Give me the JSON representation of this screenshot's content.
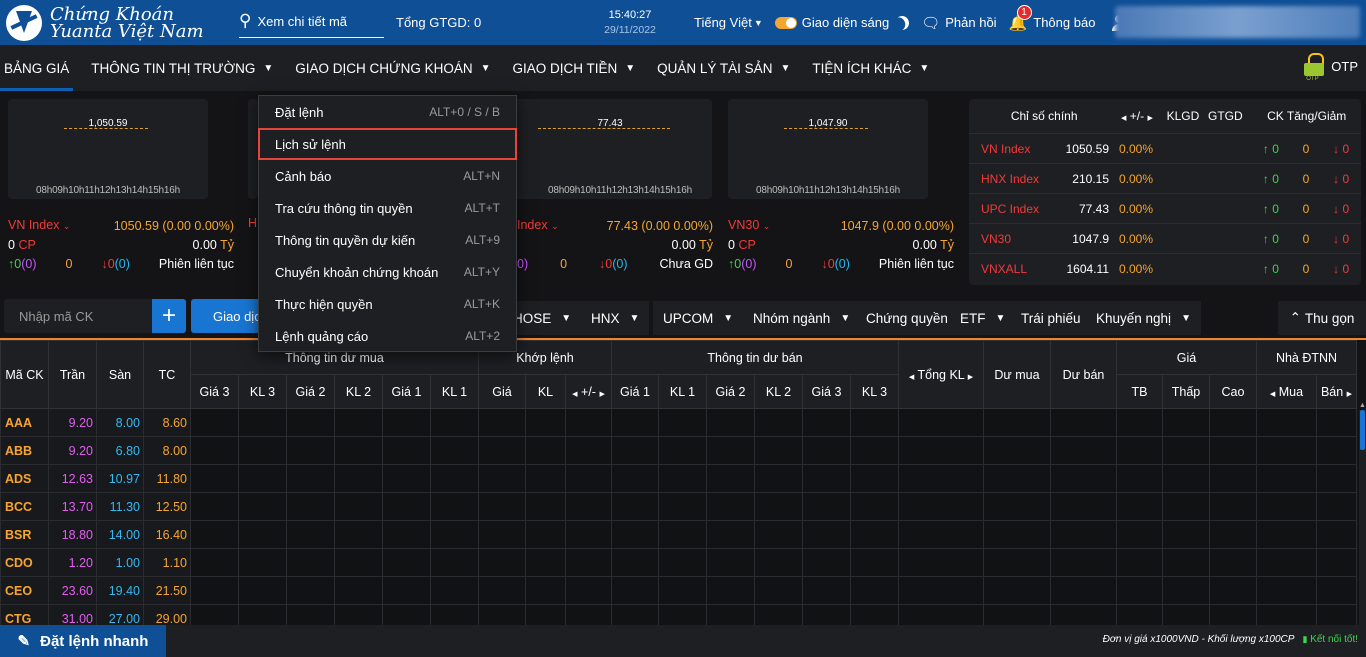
{
  "header": {
    "brand_line1": "Chứng Khoán",
    "brand_line2": "Yuanta Việt Nam",
    "search_placeholder": "Xem chi tiết mã",
    "total_gtgd": "Tổng GTGD: 0",
    "time": "15:40:27",
    "date": "29/11/2022",
    "language": "Tiếng Việt",
    "theme": "Giao diện sáng",
    "feedback": "Phản hồi",
    "notifications": "Thông báo",
    "notification_count": "1"
  },
  "menu": {
    "items": [
      "BẢNG GIÁ",
      "THÔNG TIN THỊ TRƯỜNG",
      "GIAO DỊCH CHỨNG KHOÁN",
      "GIAO DỊCH TIỀN",
      "QUẢN LÝ TÀI SẢN",
      "TIỆN ÍCH KHÁC"
    ],
    "otp": "OTP"
  },
  "dropdown": [
    {
      "label": "Đặt lệnh",
      "key": "ALT+0 / S / B"
    },
    {
      "label": "Lịch sử lệnh",
      "key": ""
    },
    {
      "label": "Cảnh báo",
      "key": "ALT+N"
    },
    {
      "label": "Tra cứu thông tin quyền",
      "key": "ALT+T"
    },
    {
      "label": "Thông tin quyền dự kiến",
      "key": "ALT+9"
    },
    {
      "label": "Chuyển khoản chứng khoán",
      "key": "ALT+Y"
    },
    {
      "label": "Thực hiện quyền",
      "key": "ALT+K"
    },
    {
      "label": "Lệnh quảng cáo",
      "key": "ALT+2"
    }
  ],
  "minicharts": [
    {
      "value": "1,050.59",
      "ticks": "08h09h10h11h12h13h14h15h16h"
    },
    {
      "value": "",
      "ticks": ""
    },
    {
      "value": "77.43",
      "ticks": "08h09h10h11h12h13h14h15h16h"
    },
    {
      "value": "1,047.90",
      "ticks": "08h09h10h11h12h13h14h15h16h"
    }
  ],
  "indices": [
    {
      "name": "VN Index",
      "value": "1050.59",
      "change": "(0.00",
      "pct": "0.00%)",
      "cp_count": "0",
      "cp": "CP",
      "amount": "0.00",
      "unit": "Tỷ",
      "up": "0",
      "up_c": "(0)",
      "ref": "0",
      "down": "0",
      "down_c": "(0)",
      "session": "Phiên liên tục"
    },
    {
      "name": "Index",
      "value": "77.43",
      "change": "(0.00",
      "pct": "0.00%)",
      "cp_count": "",
      "cp": "",
      "amount": "0.00",
      "unit": "Tỷ",
      "up": "",
      "up_c": "0)",
      "ref": "0",
      "down": "0",
      "down_c": "(0)",
      "session": "Chưa GD"
    },
    {
      "name": "VN30",
      "value": "1047.9",
      "change": "(0.00",
      "pct": "0.00%)",
      "cp_count": "0",
      "cp": "CP",
      "amount": "0.00",
      "unit": "Tỷ",
      "up": "0",
      "up_c": "(0)",
      "ref": "0",
      "down": "0",
      "down_c": "(0)",
      "session": "Phiên liên tục"
    }
  ],
  "partial_h": "H",
  "market": {
    "header": {
      "name": "Chỉ số chính",
      "chg": "+/-",
      "klgd": "KLGD",
      "gtgd": "GTGD",
      "ck": "CK Tăng/Giảm"
    },
    "rows": [
      {
        "name": "VN Index",
        "value": "1050.59",
        "pct": "0.00%",
        "up": "0",
        "ref": "0",
        "down": "0"
      },
      {
        "name": "HNX Index",
        "value": "210.15",
        "pct": "0.00%",
        "up": "0",
        "ref": "0",
        "down": "0"
      },
      {
        "name": "UPC Index",
        "value": "77.43",
        "pct": "0.00%",
        "up": "0",
        "ref": "0",
        "down": "0"
      },
      {
        "name": "VN30",
        "value": "1047.9",
        "pct": "0.00%",
        "up": "0",
        "ref": "0",
        "down": "0"
      },
      {
        "name": "VNXALL",
        "value": "1604.11",
        "pct": "0.00%",
        "up": "0",
        "ref": "0",
        "down": "0"
      }
    ]
  },
  "filter": {
    "input_placeholder": "Nhập mã CK",
    "giaodich": "Giao dịch",
    "tabs": [
      "HOSE",
      "HNX",
      "UPCOM",
      "Nhóm ngành",
      "Chứng quyền",
      "ETF",
      "Trái phiếu",
      "Khuyến nghị"
    ],
    "collapse": "Thu gọn"
  },
  "table": {
    "head1": {
      "mack": "Mã CK",
      "tran": "Trần",
      "san": "Sàn",
      "tc": "TC",
      "buy": "Thông tin dư mua",
      "match": "Khớp lệnh",
      "sell": "Thông tin dư bán",
      "tongkl": "Tổng KL",
      "dumua": "Dư mua",
      "duban": "Dư bán",
      "gia": "Giá",
      "ndtnn": "Nhà ĐTNN"
    },
    "head2": [
      "Giá 3",
      "KL 3",
      "Giá 2",
      "KL 2",
      "Giá 1",
      "KL 1",
      "Giá",
      "KL",
      "+/-",
      "Giá 1",
      "KL 1",
      "Giá 2",
      "KL 2",
      "Giá 3",
      "KL 3",
      "TB",
      "Thấp",
      "Cao",
      "Mua",
      "Bán"
    ],
    "rows": [
      {
        "ck": "AAA",
        "tran": "9.20",
        "san": "8.00",
        "tc": "8.60"
      },
      {
        "ck": "ABB",
        "tran": "9.20",
        "san": "6.80",
        "tc": "8.00"
      },
      {
        "ck": "ADS",
        "tran": "12.63",
        "san": "10.97",
        "tc": "11.80"
      },
      {
        "ck": "BCC",
        "tran": "13.70",
        "san": "11.30",
        "tc": "12.50"
      },
      {
        "ck": "BSR",
        "tran": "18.80",
        "san": "14.00",
        "tc": "16.40"
      },
      {
        "ck": "CDO",
        "tran": "1.20",
        "san": "1.00",
        "tc": "1.10"
      },
      {
        "ck": "CEO",
        "tran": "23.60",
        "san": "19.40",
        "tc": "21.50"
      },
      {
        "ck": "CTG",
        "tran": "31.00",
        "san": "27.00",
        "tc": "29.00"
      }
    ]
  },
  "footer": {
    "quick": "Đặt lệnh nhanh",
    "info": "Đơn vị giá x1000VND - Khối lượng x100CP",
    "status": "Kết nối tốt!"
  }
}
